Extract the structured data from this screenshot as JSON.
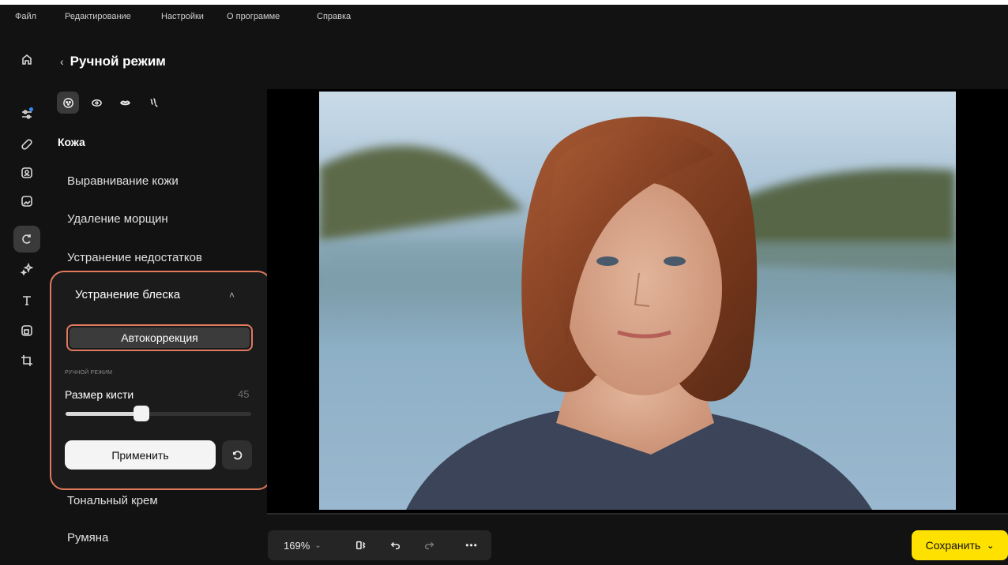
{
  "menu": [
    "Файл",
    "Редактирование",
    "Настройки",
    "О программе",
    "Справка"
  ],
  "panel": {
    "back_title": "Ручной режим",
    "section": "Кожа",
    "items": [
      "Выравнивание кожи",
      "Удаление морщин",
      "Устранение недостатков"
    ],
    "items_after": [
      "Тональный крем",
      "Румяна"
    ]
  },
  "glare": {
    "title": "Устранение блеска",
    "auto_button": "Автокоррекция",
    "mode_caption": "РУЧНОЙ РЕЖИМ",
    "brush_label": "Размер кисти",
    "brush_value": "45",
    "brush_fraction": 0.41,
    "apply_button": "Применить"
  },
  "toolbar": {
    "zoom": "169%",
    "more": "•••"
  },
  "save_button": "Сохранить",
  "colors": {
    "accent_outline": "#e07a5f",
    "save_bg": "#ffe100",
    "notify_dot": "#2f8cff"
  }
}
